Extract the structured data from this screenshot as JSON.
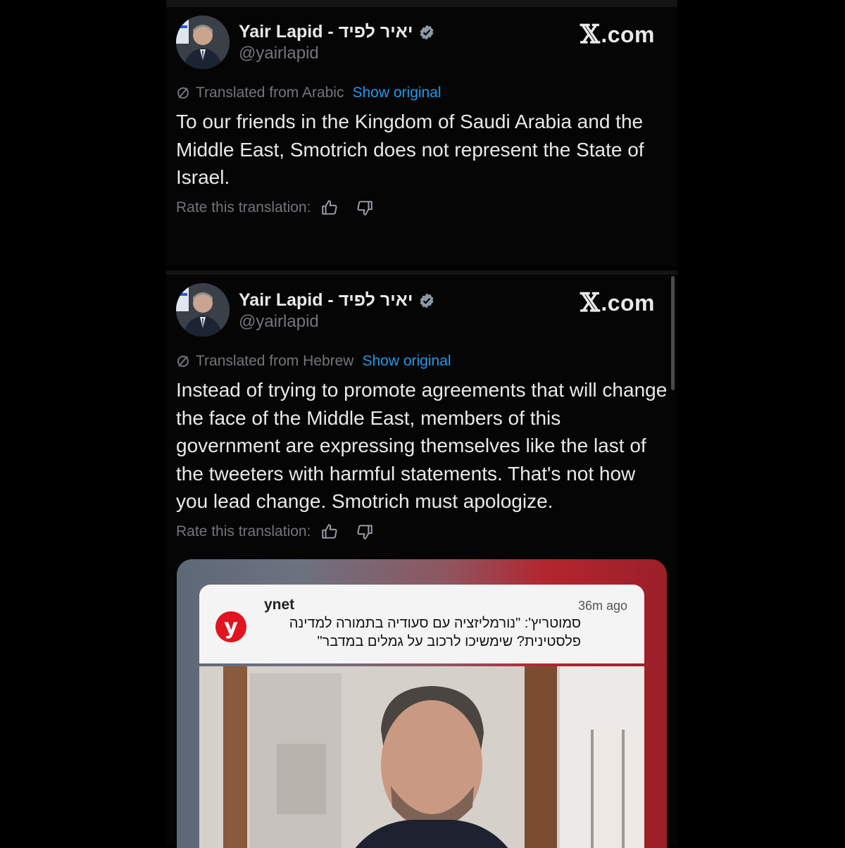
{
  "tweets": [
    {
      "author_name": "Yair Lapid - יאיר לפיד",
      "handle": "@yairlapid",
      "site": "X.com",
      "site_x": "𝕏",
      "site_suffix": ".com",
      "translated_from": "Translated from Arabic",
      "show_original": "Show original",
      "text": "To our friends in the Kingdom of Saudi Arabia and the Middle East, Smotrich does not represent the State of Israel.",
      "rate_label": "Rate this translation:"
    },
    {
      "author_name": "Yair Lapid - יאיר לפיד",
      "handle": "@yairlapid",
      "site": "X.com",
      "site_x": "𝕏",
      "site_suffix": ".com",
      "translated_from": "Translated from Hebrew",
      "show_original": "Show original",
      "text": "Instead of trying to promote agreements that will change the face of the Middle East, members of this government are expressing themselves like the last of the tweeters with harmful statements. That's not how you lead change. Smotrich must apologize.",
      "rate_label": "Rate this translation:"
    }
  ],
  "embed": {
    "source": "ynet",
    "logo_letter": "y",
    "time": "36m ago",
    "headline": "סמוטריץ': \"נורמליזציה עם סעודיה בתמורה למדינה פלסטינית? שימשיכו לרכוב על גמלים במדבר\""
  },
  "colors": {
    "background": "#000000",
    "link": "#1d9bf0",
    "muted": "#71767b",
    "verified": "#8b98a5",
    "ynet_red": "#e0151f"
  },
  "icons": [
    "verified-badge-icon",
    "translate-icon",
    "thumbs-up-icon",
    "thumbs-down-icon"
  ]
}
